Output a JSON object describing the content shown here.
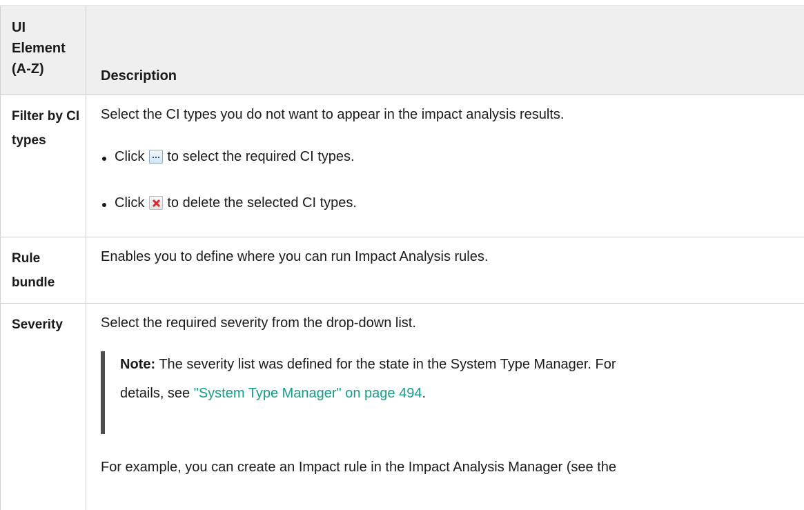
{
  "header": {
    "col1_label": "UI Element (A-Z)",
    "col2_label": "Description"
  },
  "rows": [
    {
      "name": "Filter by CI types",
      "description": "Select the CI types you do not want to appear in the impact analysis results.",
      "bullets": [
        {
          "before": "Click",
          "icon": "ellipsis-button-icon",
          "after": "to select the required CI types."
        },
        {
          "before": "Click",
          "icon": "red-x-delete-icon",
          "after": "to delete the selected CI types."
        }
      ]
    },
    {
      "name": "Rule bundle",
      "description": "Enables you to define where you can run Impact Analysis rules."
    },
    {
      "name": "Severity",
      "description": "Select the required severity from the drop-down list.",
      "note": {
        "label": "Note:",
        "text_line1": "The severity list was defined for the state in the System Type Manager. For",
        "text_line2_prefix": "details, see",
        "link_text": "\"System Type Manager\" on page 494",
        "text_line2_suffix": "."
      },
      "example": "For example, you can create an Impact rule in the Impact Analysis Manager (see the"
    }
  ]
}
